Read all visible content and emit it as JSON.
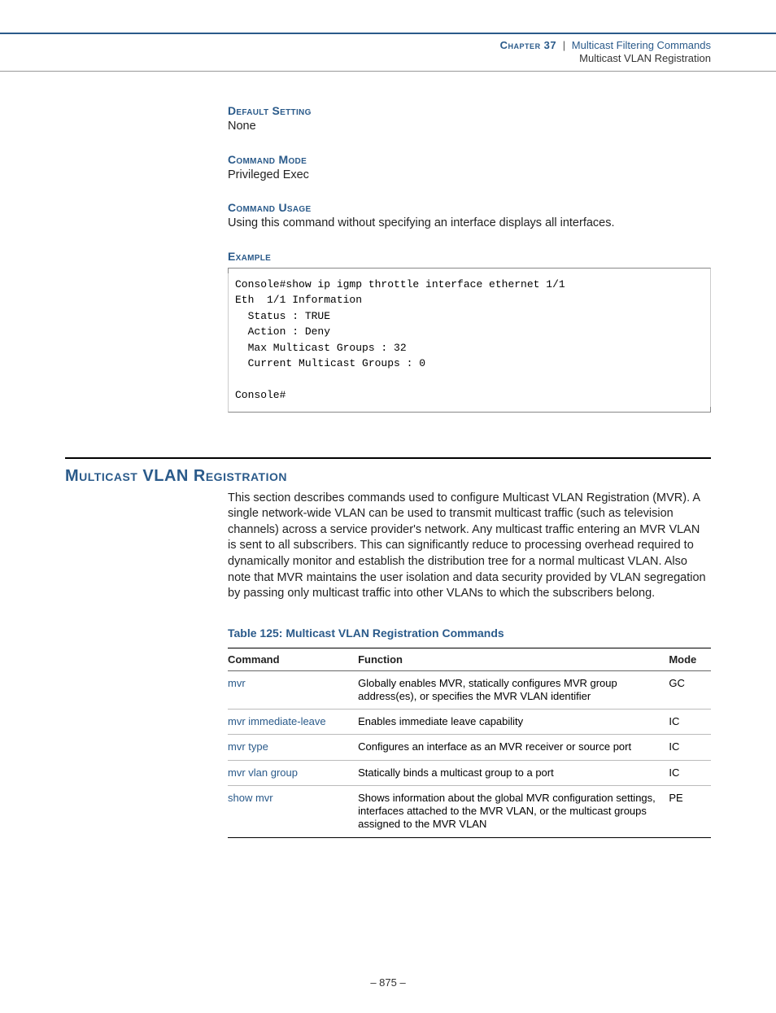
{
  "header": {
    "chapter_label": "Chapter 37",
    "separator": "|",
    "chapter_title": "Multicast Filtering Commands",
    "subsection": "Multicast VLAN Registration"
  },
  "sections": {
    "default_setting": {
      "heading": "Default Setting",
      "text": "None"
    },
    "command_mode": {
      "heading": "Command Mode",
      "text": "Privileged Exec"
    },
    "command_usage": {
      "heading": "Command Usage",
      "text": "Using this command without specifying an interface displays all interfaces."
    },
    "example": {
      "heading": "Example",
      "code": "Console#show ip igmp throttle interface ethernet 1/1\nEth  1/1 Information\n  Status : TRUE\n  Action : Deny\n  Max Multicast Groups : 32\n  Current Multicast Groups : 0\n\nConsole#"
    }
  },
  "main_section": {
    "heading": "Multicast VLAN Registration",
    "body": "This section describes commands used to configure Multicast VLAN Registration (MVR). A single network-wide VLAN can be used to transmit multicast traffic (such as television channels) across a service provider's network. Any multicast traffic entering an MVR VLAN is sent to all subscribers. This can significantly reduce to processing overhead required to dynamically monitor and establish the distribution tree for a normal multicast VLAN. Also note that MVR maintains the user isolation and data security provided by VLAN segregation by passing only multicast traffic into other VLANs to which the subscribers belong."
  },
  "table": {
    "caption": "Table 125: Multicast VLAN Registration Commands",
    "headers": {
      "command": "Command",
      "function": "Function",
      "mode": "Mode"
    },
    "rows": [
      {
        "command": "mvr",
        "function": "Globally enables MVR, statically configures MVR group address(es), or specifies the MVR VLAN identifier",
        "mode": "GC"
      },
      {
        "command": "mvr immediate-leave",
        "function": "Enables immediate leave capability",
        "mode": "IC"
      },
      {
        "command": "mvr type",
        "function": "Configures an interface as an MVR receiver or source port",
        "mode": "IC"
      },
      {
        "command": "mvr vlan group",
        "function": "Statically binds a multicast group to a port",
        "mode": "IC"
      },
      {
        "command": "show mvr",
        "function": "Shows information about the global MVR configuration settings, interfaces attached to the MVR VLAN, or the multicast groups assigned to the MVR VLAN",
        "mode": "PE"
      }
    ]
  },
  "page_number": "–  875  –"
}
